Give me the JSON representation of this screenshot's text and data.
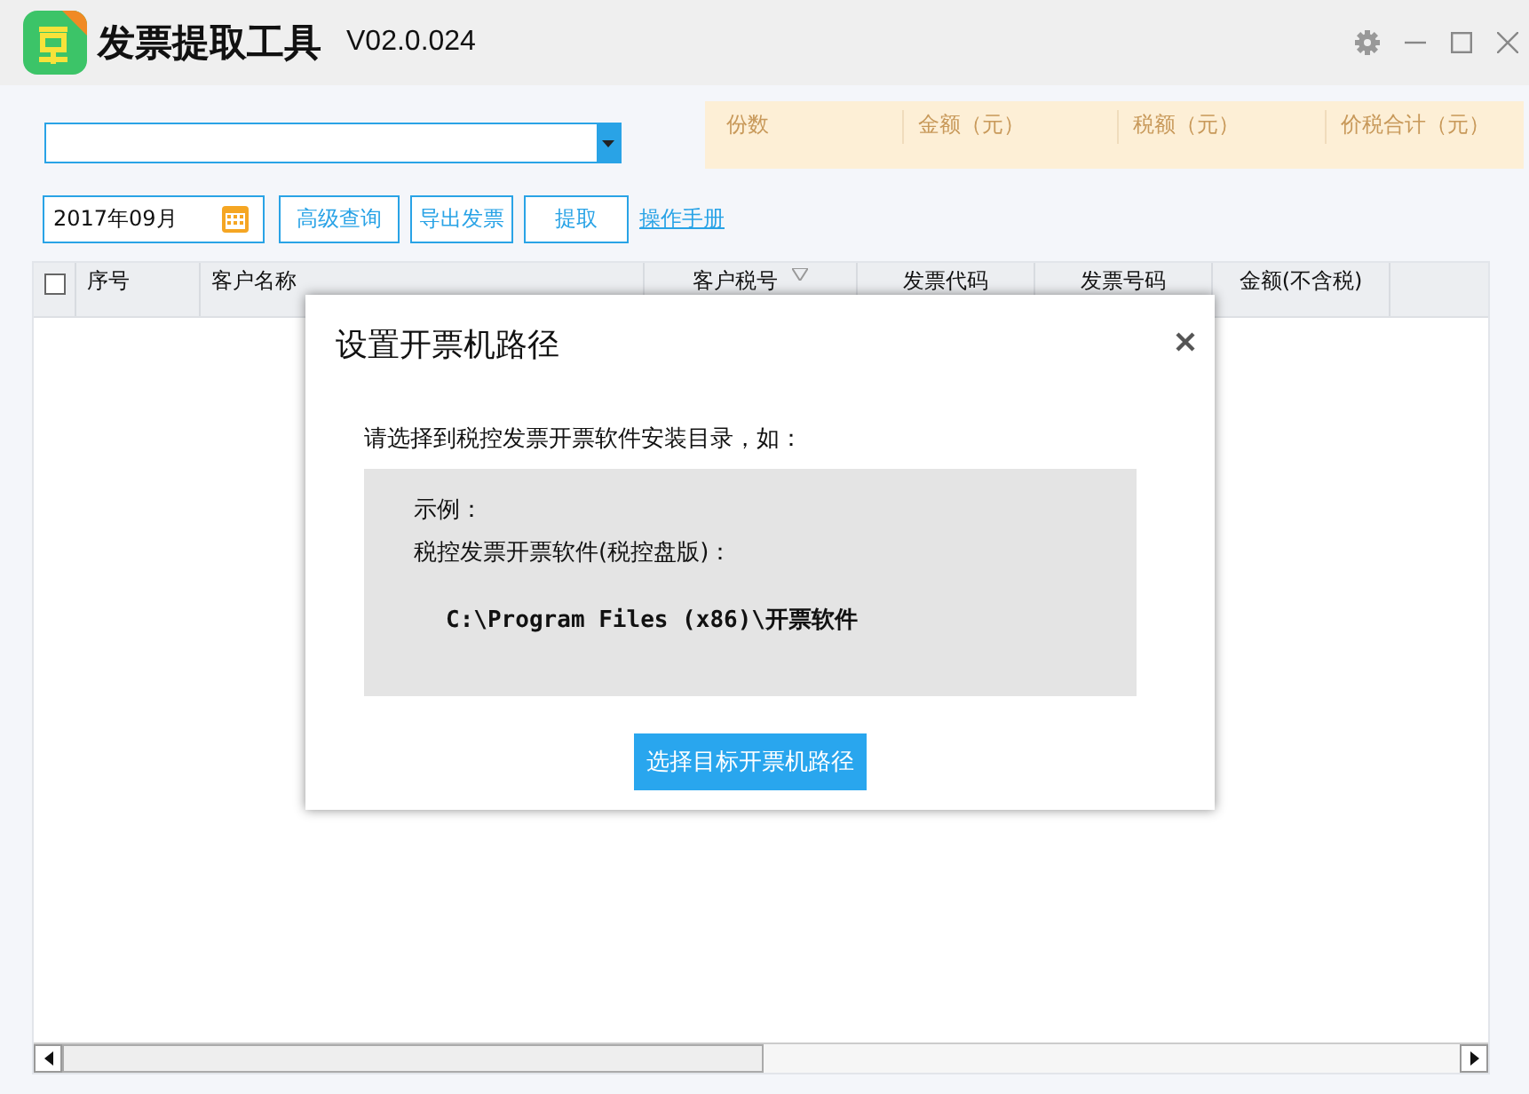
{
  "window": {
    "title": "发票提取工具",
    "version": "V02.0.024"
  },
  "summary": [
    "份数",
    "金额（元）",
    "税额（元）",
    "价税合计（元）"
  ],
  "toolbar": {
    "date": "2017年09月",
    "buttons": [
      "高级查询",
      "导出发票",
      "提取"
    ],
    "link": "操作手册"
  },
  "table": {
    "select_all": {
      "checked": false
    },
    "columns": [
      {
        "label": "序号",
        "sortable": false
      },
      {
        "label": "客户名称",
        "sortable": false
      },
      {
        "label": "客户税号",
        "sortable": true
      },
      {
        "label": "发票代码",
        "sortable": false
      },
      {
        "label": "发票号码",
        "sortable": false
      },
      {
        "label": "金额(不含税)",
        "sortable": false
      }
    ]
  },
  "dialog": {
    "title": "设置开票机路径",
    "instruction": "请选择到税控发票开票软件安装目录，如：",
    "example_label": "示例：",
    "example_name": "税控发票开票软件(税控盘版)：",
    "example_path": "C:\\Program Files (x86)\\开票软件",
    "button": "选择目标开票机路径"
  }
}
